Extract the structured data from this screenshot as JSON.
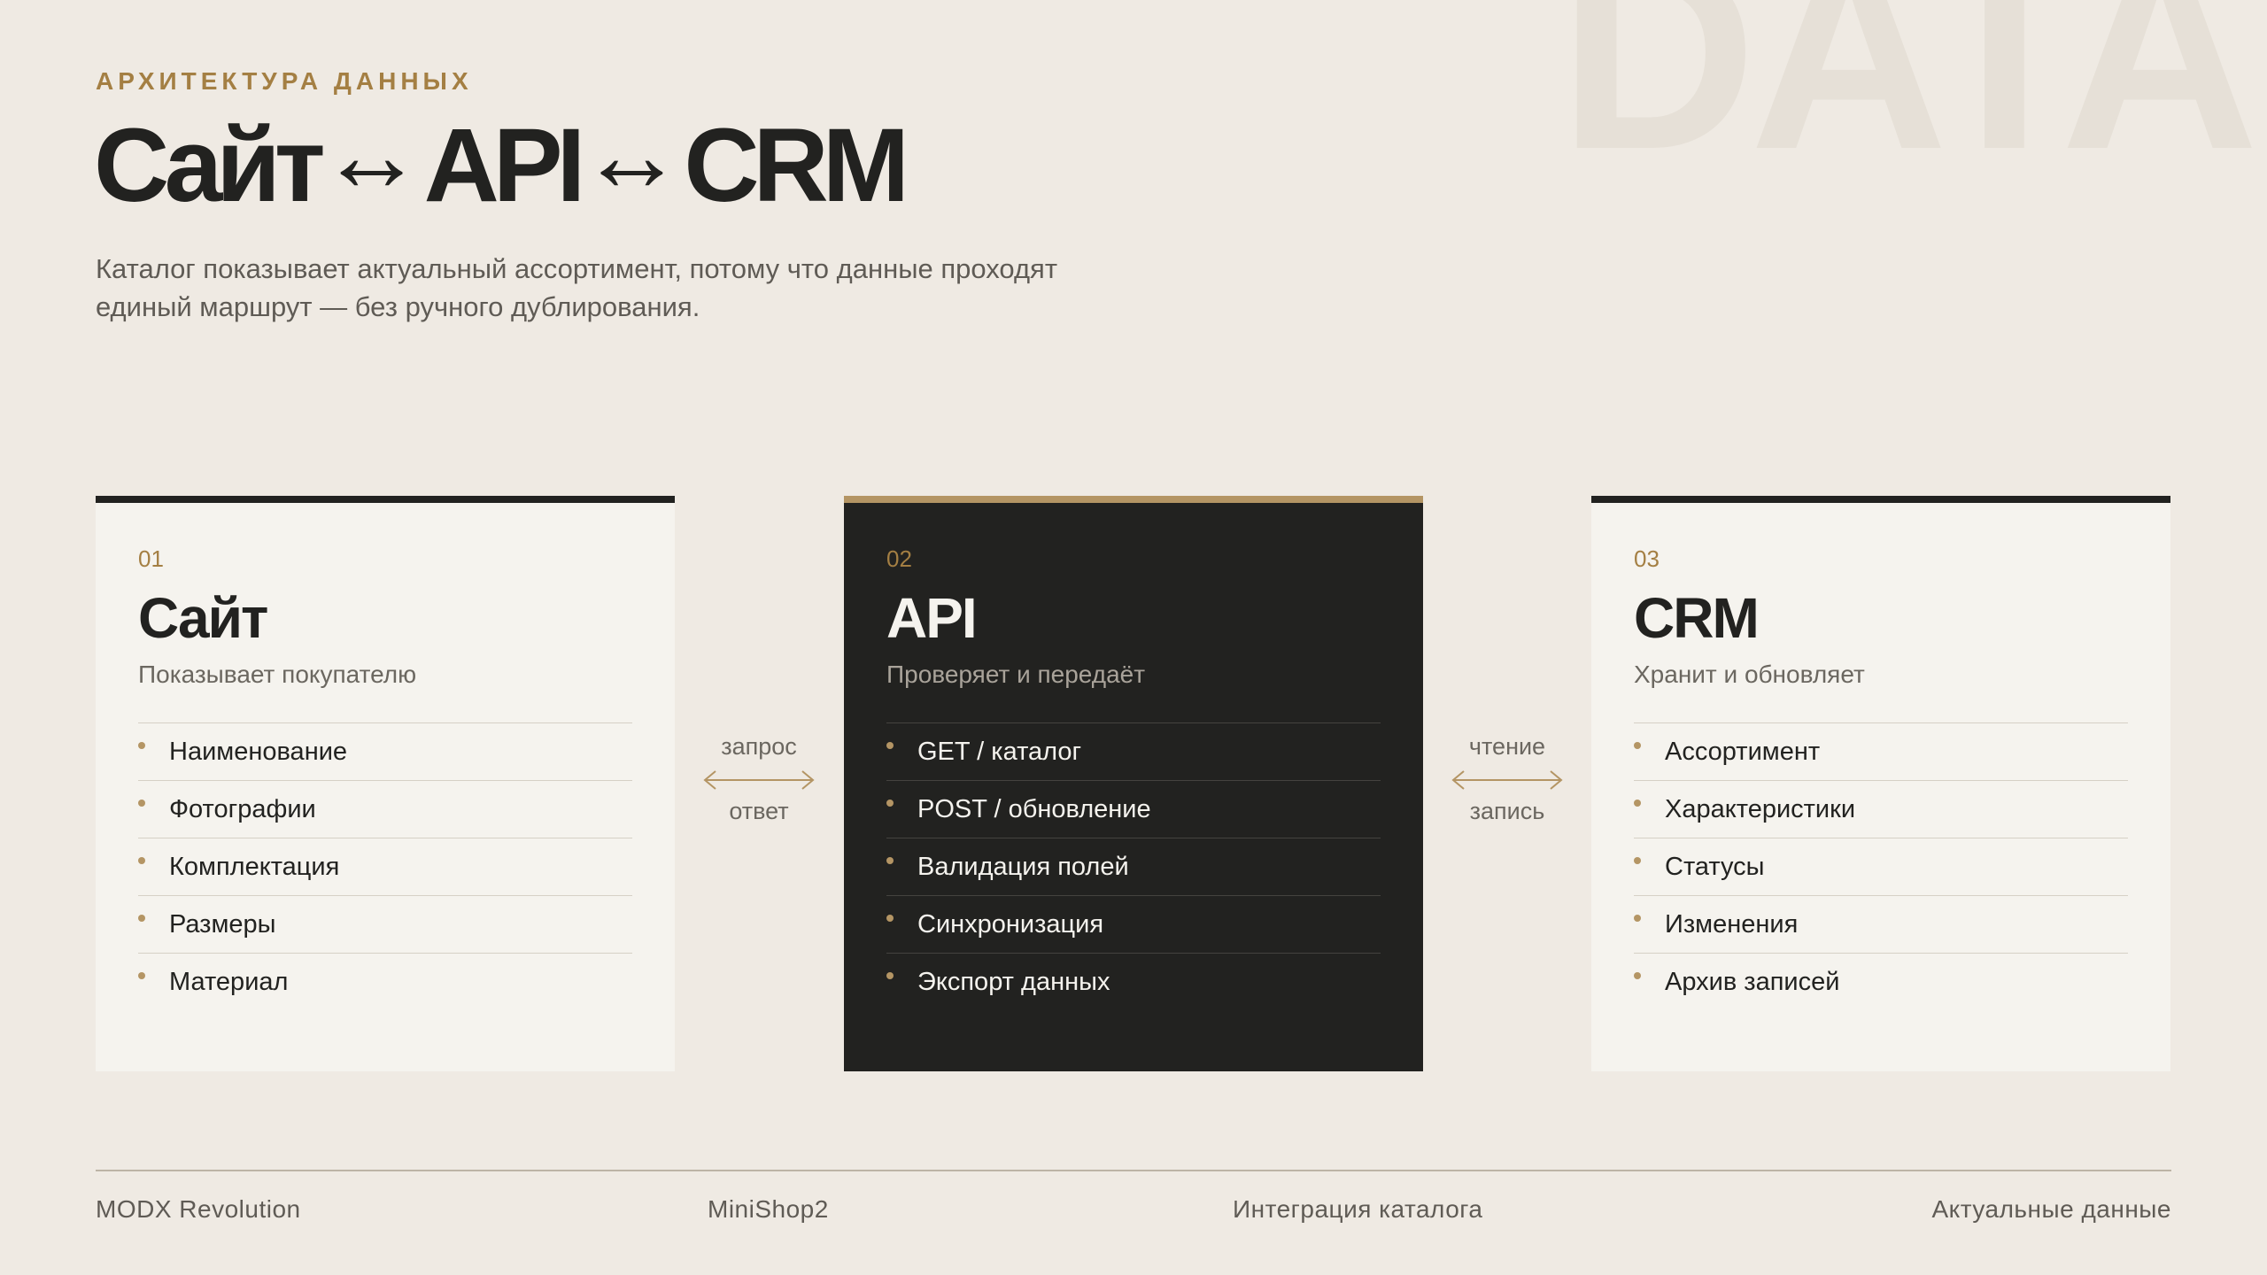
{
  "background_word": "DATA",
  "header": {
    "eyebrow": "АРХИТЕКТУРА ДАННЫХ",
    "title_parts": [
      "Сайт",
      "↔",
      "API",
      "↔",
      "CRM"
    ],
    "subtitle": "Каталог показывает актуальный ассортимент, потому что данные проходят единый маршрут — без ручного дублирования."
  },
  "cards": [
    {
      "number": "01",
      "title": "Сайт",
      "subtitle": "Показывает покупателю",
      "items": [
        "Наименование",
        "Фотографии",
        "Комплектация",
        "Размеры",
        "Материал"
      ]
    },
    {
      "number": "02",
      "title": "API",
      "subtitle": "Проверяет и передаёт",
      "items": [
        "GET / каталог",
        "POST / обновление",
        "Валидация полей",
        "Синхронизация",
        "Экспорт данных"
      ]
    },
    {
      "number": "03",
      "title": "CRM",
      "subtitle": "Хранит и обновляет",
      "items": [
        "Ассортимент",
        "Характеристики",
        "Статусы",
        "Изменения",
        "Архив записей"
      ]
    }
  ],
  "connectors": [
    {
      "top_label": "запрос",
      "bottom_label": "ответ"
    },
    {
      "top_label": "чтение",
      "bottom_label": "запись"
    }
  ],
  "footer": [
    "MODX Revolution",
    "MiniShop2",
    "Интеграция каталога",
    "Актуальные данные"
  ],
  "colors": {
    "background": "#efeae3",
    "accent": "#a47f43",
    "dark": "#222220",
    "card_light": "#f5f3ee"
  }
}
